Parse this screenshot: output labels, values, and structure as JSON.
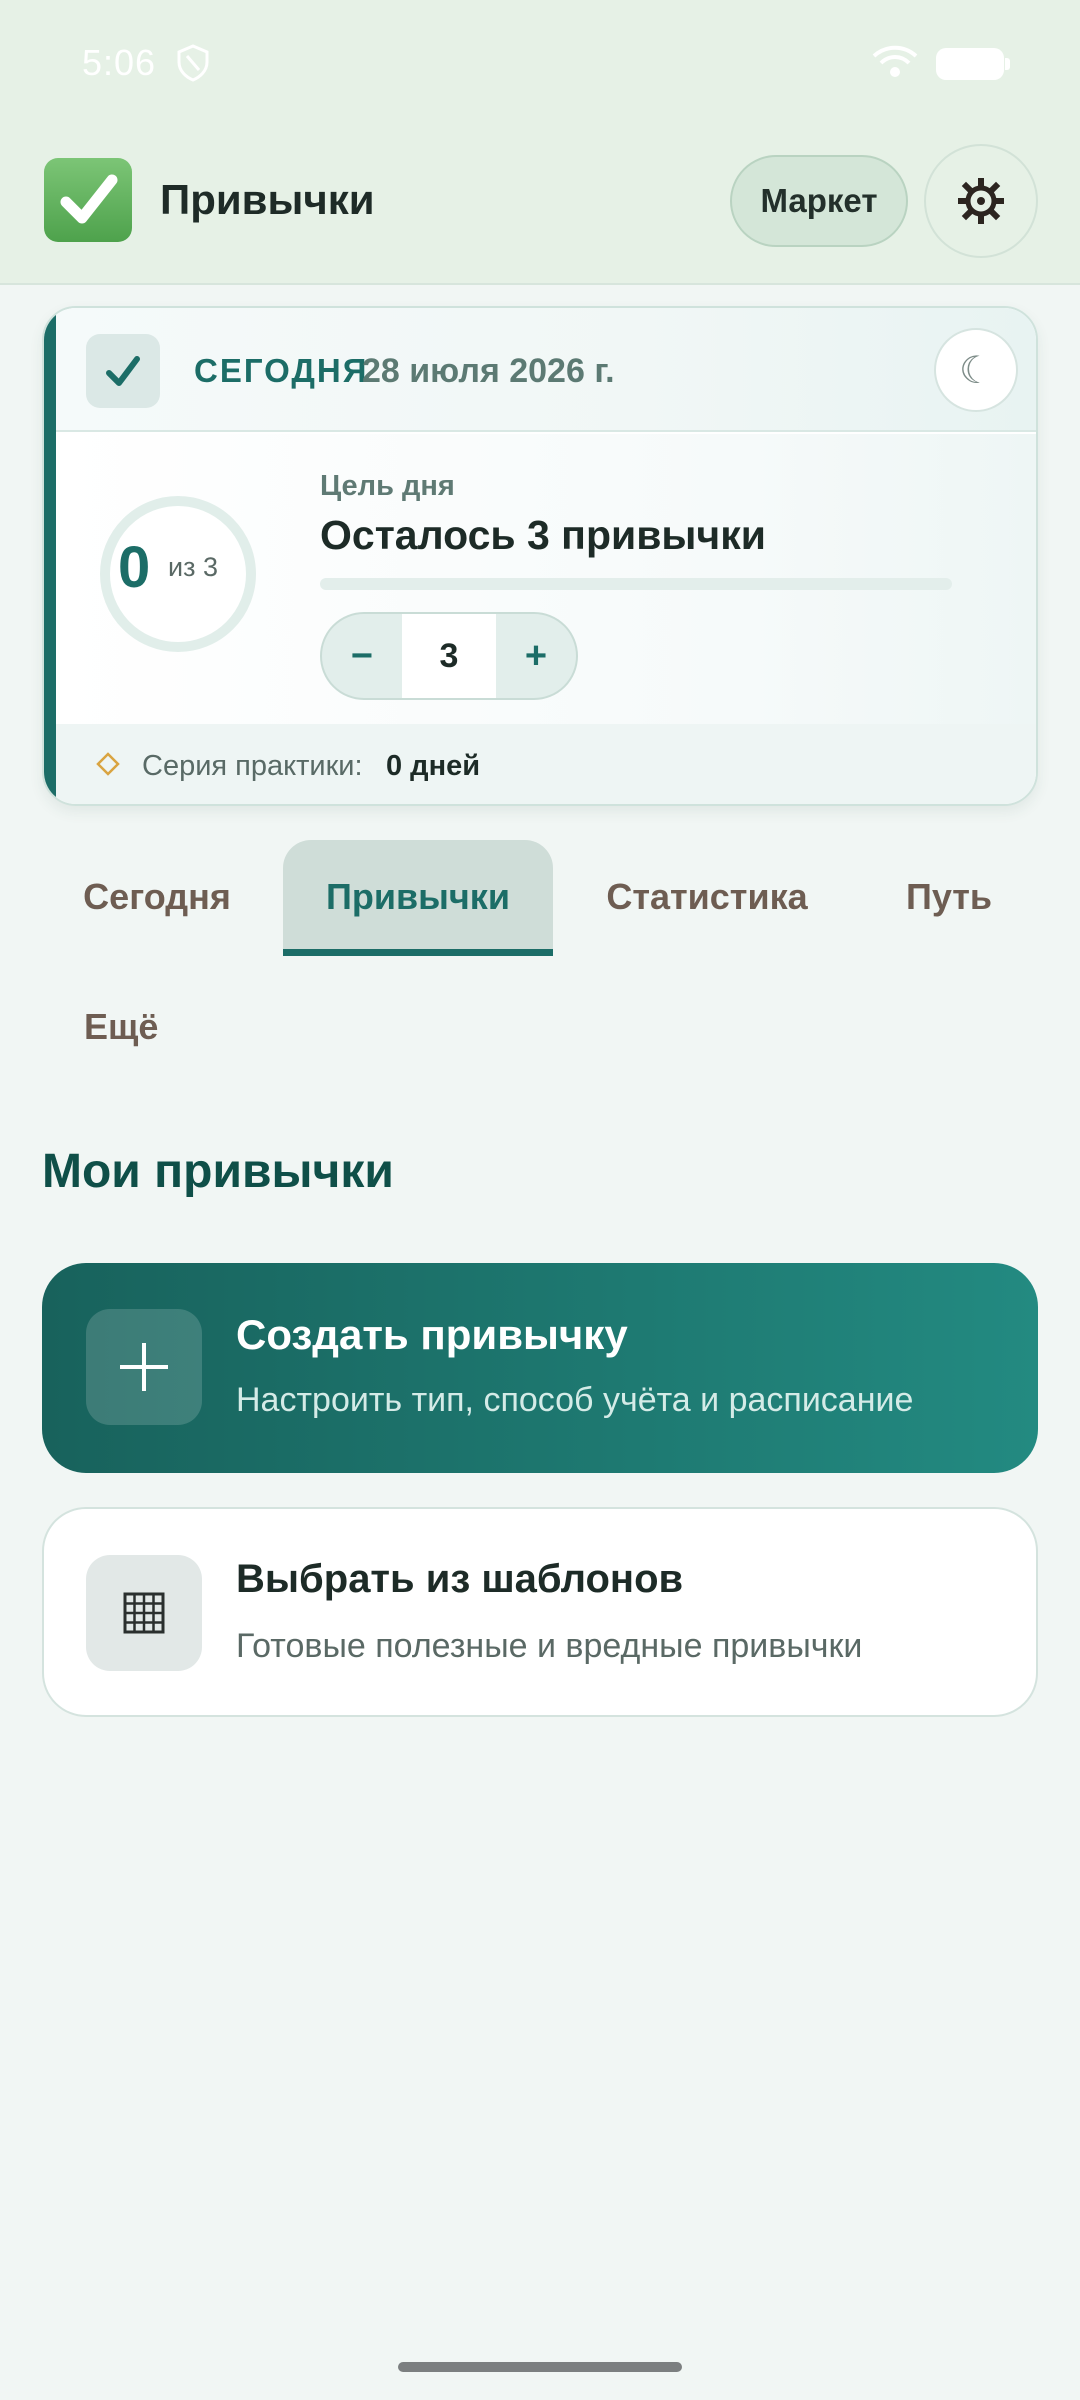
{
  "status_bar": {
    "time": "5:06"
  },
  "app_bar": {
    "title": "Привычки",
    "market_label": "Маркет",
    "icons": [
      "check-mark-logo-icon",
      "gear-icon"
    ]
  },
  "today_card": {
    "today_label": "сегодня",
    "date": "28 июля 2026 г.",
    "moon_glyph": "☾",
    "completed": "0",
    "of_total": "из 3",
    "goal_label": "Цель дня",
    "goal_text": "Осталось 3 привычки",
    "progress_fraction": 0,
    "stepper": {
      "minus": "−",
      "value": "3",
      "plus": "+"
    },
    "streak_label": "Серия практики:",
    "streak_value": "0 дней"
  },
  "tabs": [
    {
      "label": "Сегодня",
      "active": false
    },
    {
      "label": "Привычки",
      "active": true
    },
    {
      "label": "Статистика",
      "active": false
    },
    {
      "label": "Путь",
      "active": false
    },
    {
      "label": "Ещё",
      "active": false
    }
  ],
  "section": {
    "title": "Мои привычки"
  },
  "create_card": {
    "title": "Создать привычку",
    "subtitle": "Настроить тип, способ учёта и расписание"
  },
  "template_card": {
    "title": "Выбрать из шаблонов",
    "subtitle": "Готовые полезные и вредные привычки"
  },
  "colors": {
    "accent": "#1c6d67",
    "header_bg": "#e6f1e6",
    "page_bg": "#f1f6f4"
  }
}
